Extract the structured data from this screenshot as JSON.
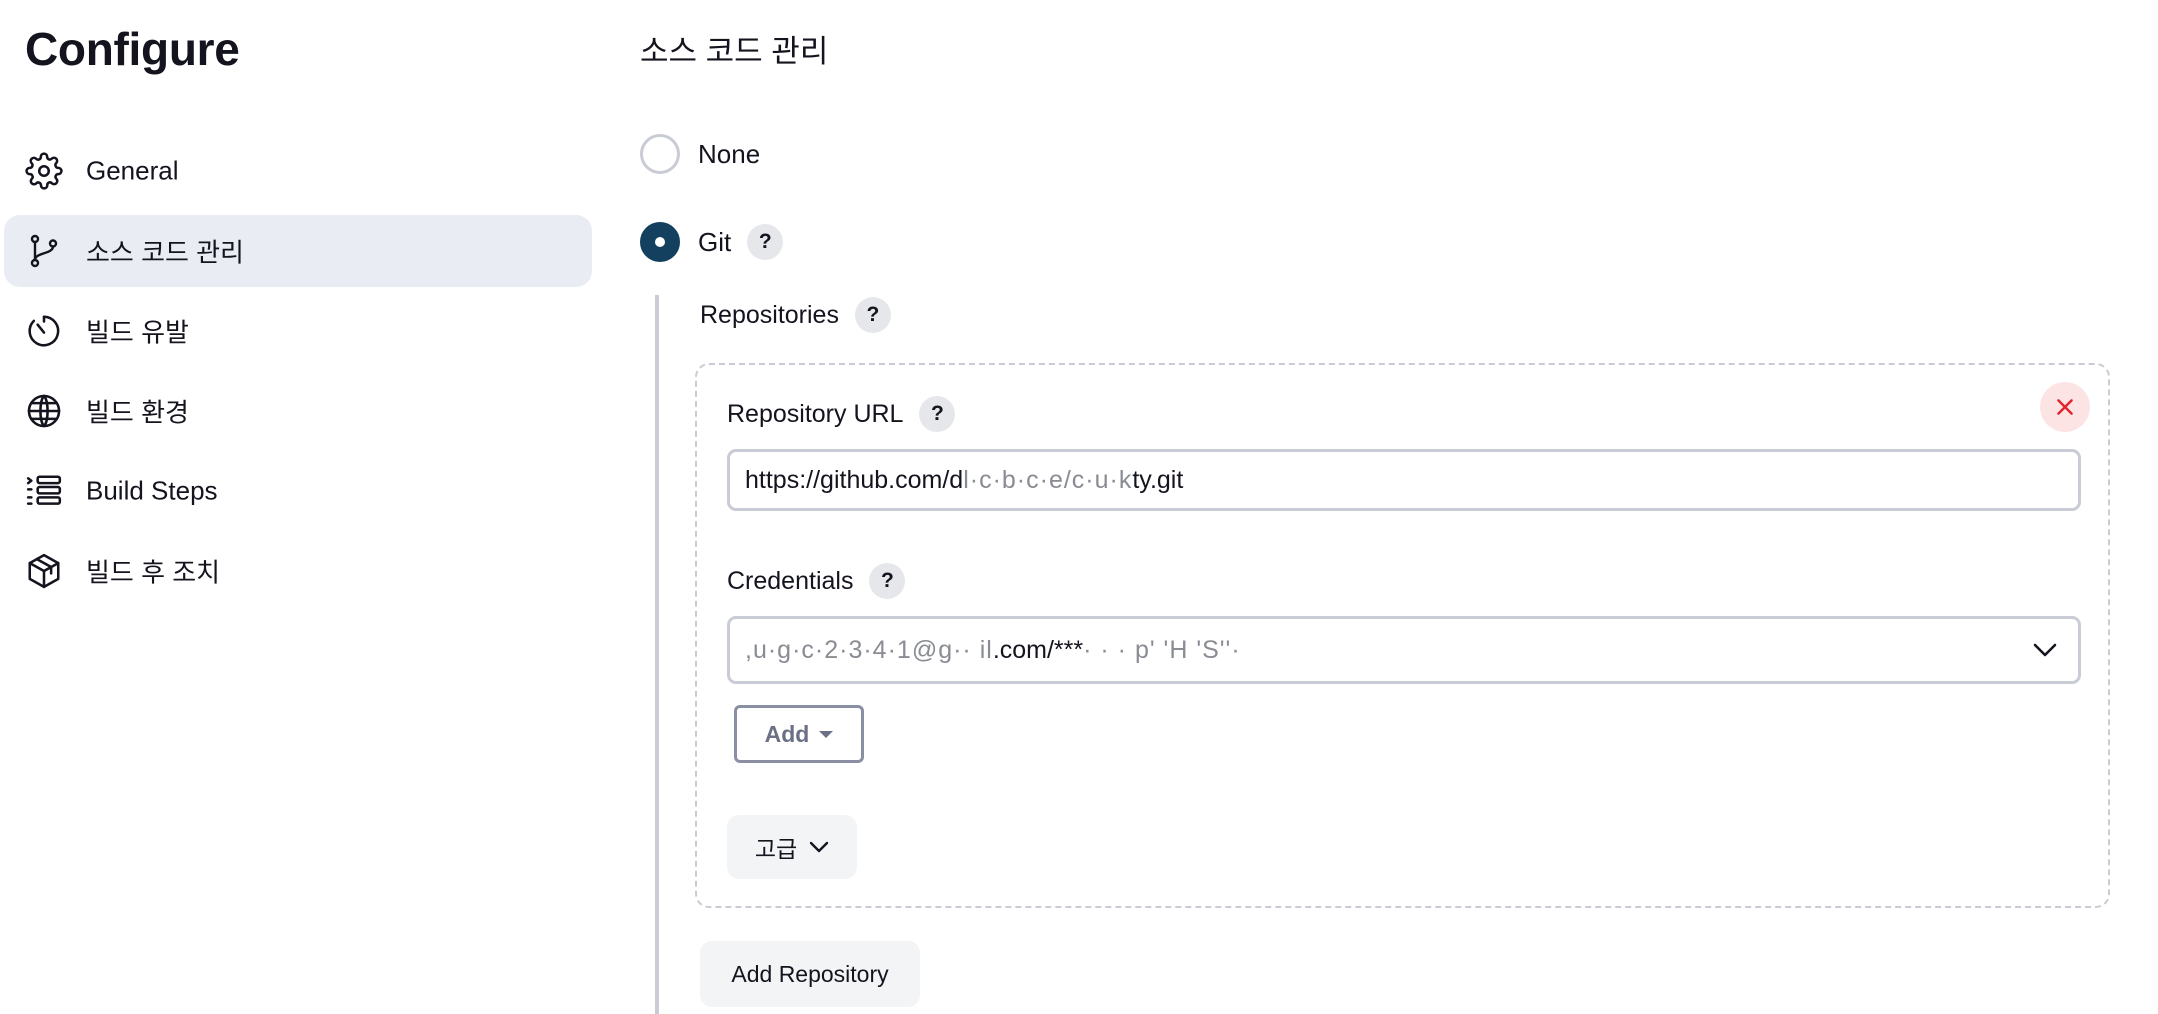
{
  "sidebar": {
    "title": "Configure",
    "items": [
      {
        "label": "General",
        "icon": "gear-icon"
      },
      {
        "label": "소스 코드 관리",
        "icon": "git-branch-icon",
        "active": true
      },
      {
        "label": "빌드 유발",
        "icon": "timer-icon"
      },
      {
        "label": "빌드 환경",
        "icon": "globe-icon"
      },
      {
        "label": "Build Steps",
        "icon": "list-steps-icon"
      },
      {
        "label": "빌드 후 조치",
        "icon": "package-icon"
      }
    ]
  },
  "main": {
    "section_title": "소스 코드 관리",
    "scm_options": [
      {
        "label": "None",
        "selected": false
      },
      {
        "label": "Git",
        "selected": true
      }
    ],
    "help_glyph": "?",
    "repositories_label": "Repositories",
    "repository": {
      "url_label": "Repository URL",
      "url_value_prefix": "https://github.com/d",
      "url_value_redacted": "l·c·b·c·e/c·u·k",
      "url_value_suffix": "ty.git",
      "credentials_label": "Credentials",
      "credentials_prefix": "",
      "credentials_redacted_user": ",u·g·c·2·3·4·1@g·· il",
      "credentials_middle": ".com/***",
      "credentials_redacted_tail": "· · · p' 'H 'S''·"
    },
    "add_button_label": "Add",
    "advanced_label": "고급",
    "add_repository_label": "Add Repository"
  },
  "colors": {
    "active_nav_bg": "#eaecf4",
    "radio_checked": "#14405f",
    "close_bg": "#fde4e4",
    "close_x": "#e0242f",
    "border": "#c9ccd4"
  }
}
